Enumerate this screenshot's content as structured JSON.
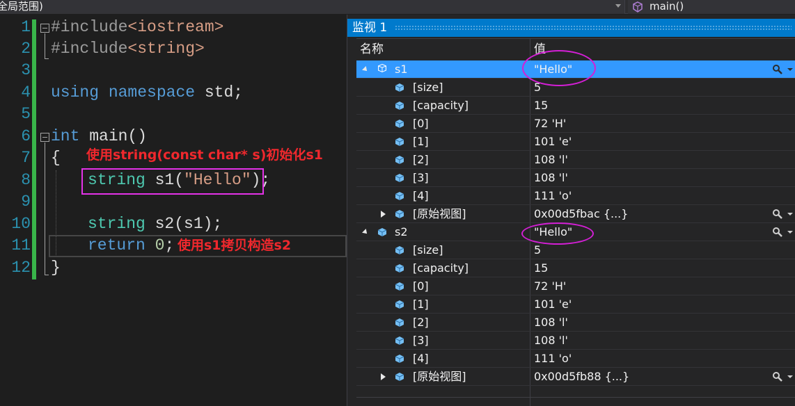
{
  "nav": {
    "scope_text": "全局范围)",
    "function_text": "main()"
  },
  "editor": {
    "line_numbers": [
      "1",
      "2",
      "3",
      "4",
      "5",
      "6",
      "7",
      "8",
      "9",
      "10",
      "11",
      "12"
    ],
    "lines": {
      "l1_pp": "#include",
      "l1_arg": "<iostream>",
      "l2_pp": "#include",
      "l2_arg": "<string>",
      "l4_kw1": "using",
      "l4_kw2": "namespace",
      "l4_rest": " std;",
      "l6_kw": "int",
      "l6_rest": " main()",
      "l7": "{",
      "l8_type": "string",
      "l8_mid": " s1(",
      "l8_str": "\"Hello\"",
      "l8_end": ");",
      "l10_type": "string",
      "l10_rest": " s2(s1);",
      "l11_kw": "return",
      "l11_num": "0",
      "l11_end": ";",
      "l12": "}"
    },
    "annotations": {
      "construct_note": "使用string(const char* s)初始化s1",
      "copy_note": "使用s1拷贝构造s2"
    },
    "annotation_color": "#f0282d"
  },
  "watch": {
    "title": "监视 1",
    "columns": {
      "name": "名称",
      "value": "值"
    },
    "rows": [
      {
        "name": "s1",
        "value": "\"Hello\""
      },
      {
        "name": "[size]",
        "value": "5"
      },
      {
        "name": "[capacity]",
        "value": "15"
      },
      {
        "name": "[0]",
        "value": "72 'H'"
      },
      {
        "name": "[1]",
        "value": "101 'e'"
      },
      {
        "name": "[2]",
        "value": "108 'l'"
      },
      {
        "name": "[3]",
        "value": "108 'l'"
      },
      {
        "name": "[4]",
        "value": "111 'o'"
      },
      {
        "name": "[原始视图]",
        "value": "0x00d5fbac {...}"
      },
      {
        "name": "s2",
        "value": "\"Hello\""
      },
      {
        "name": "[size]",
        "value": "5"
      },
      {
        "name": "[capacity]",
        "value": "15"
      },
      {
        "name": "[0]",
        "value": "72 'H'"
      },
      {
        "name": "[1]",
        "value": "101 'e'"
      },
      {
        "name": "[2]",
        "value": "108 'l'"
      },
      {
        "name": "[3]",
        "value": "108 'l'"
      },
      {
        "name": "[4]",
        "value": "111 'o'"
      },
      {
        "name": "[原始视图]",
        "value": "0x00d5fb88 {...}"
      }
    ],
    "title_color": "#007acc",
    "selected_row_color": "#3399ff",
    "highlight_color": "#d41fd6"
  }
}
